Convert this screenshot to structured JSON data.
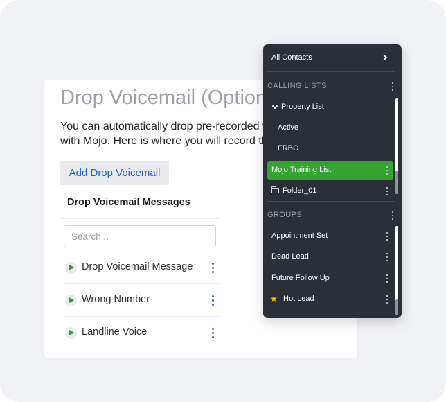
{
  "card": {
    "title": "Drop Voicemail (Optional)",
    "description_line1": "You can automatically drop pre-recorded voicemails",
    "description_line2": "with Mojo. Here is where you will record them.",
    "add_button_label": "Add Drop Voicemail",
    "messages_title": "Drop Voicemail Messages",
    "search_placeholder": "Search...",
    "messages": [
      {
        "label": "Drop Voicemail Message"
      },
      {
        "label": "Wrong Number"
      },
      {
        "label": "Landline Voice"
      }
    ]
  },
  "panel": {
    "all_contacts": "All Contacts",
    "calling_lists_header": "CALLING LISTS",
    "calling_lists": [
      {
        "label": "Property List",
        "expanded": true,
        "icon": "chevron-down-icon"
      },
      {
        "label": "Active",
        "indent": true
      },
      {
        "label": "FRBO",
        "indent": true
      },
      {
        "label": "Mojo Training List",
        "selected": true
      },
      {
        "label": "Folder_01",
        "icon": "folder-icon"
      }
    ],
    "groups_header": "GROUPS",
    "groups": [
      {
        "label": "Appointment Set"
      },
      {
        "label": "Dead Lead"
      },
      {
        "label": "Future Follow Up"
      },
      {
        "label": "Hot Lead",
        "icon": "star-icon"
      }
    ]
  },
  "colors": {
    "background": "#f1f2f6",
    "panel_bg": "#2b2f37",
    "selected_green": "#37a234",
    "link_blue": "#1f63c6",
    "play_green": "#2e9a38",
    "star_yellow": "#f3c41a"
  }
}
